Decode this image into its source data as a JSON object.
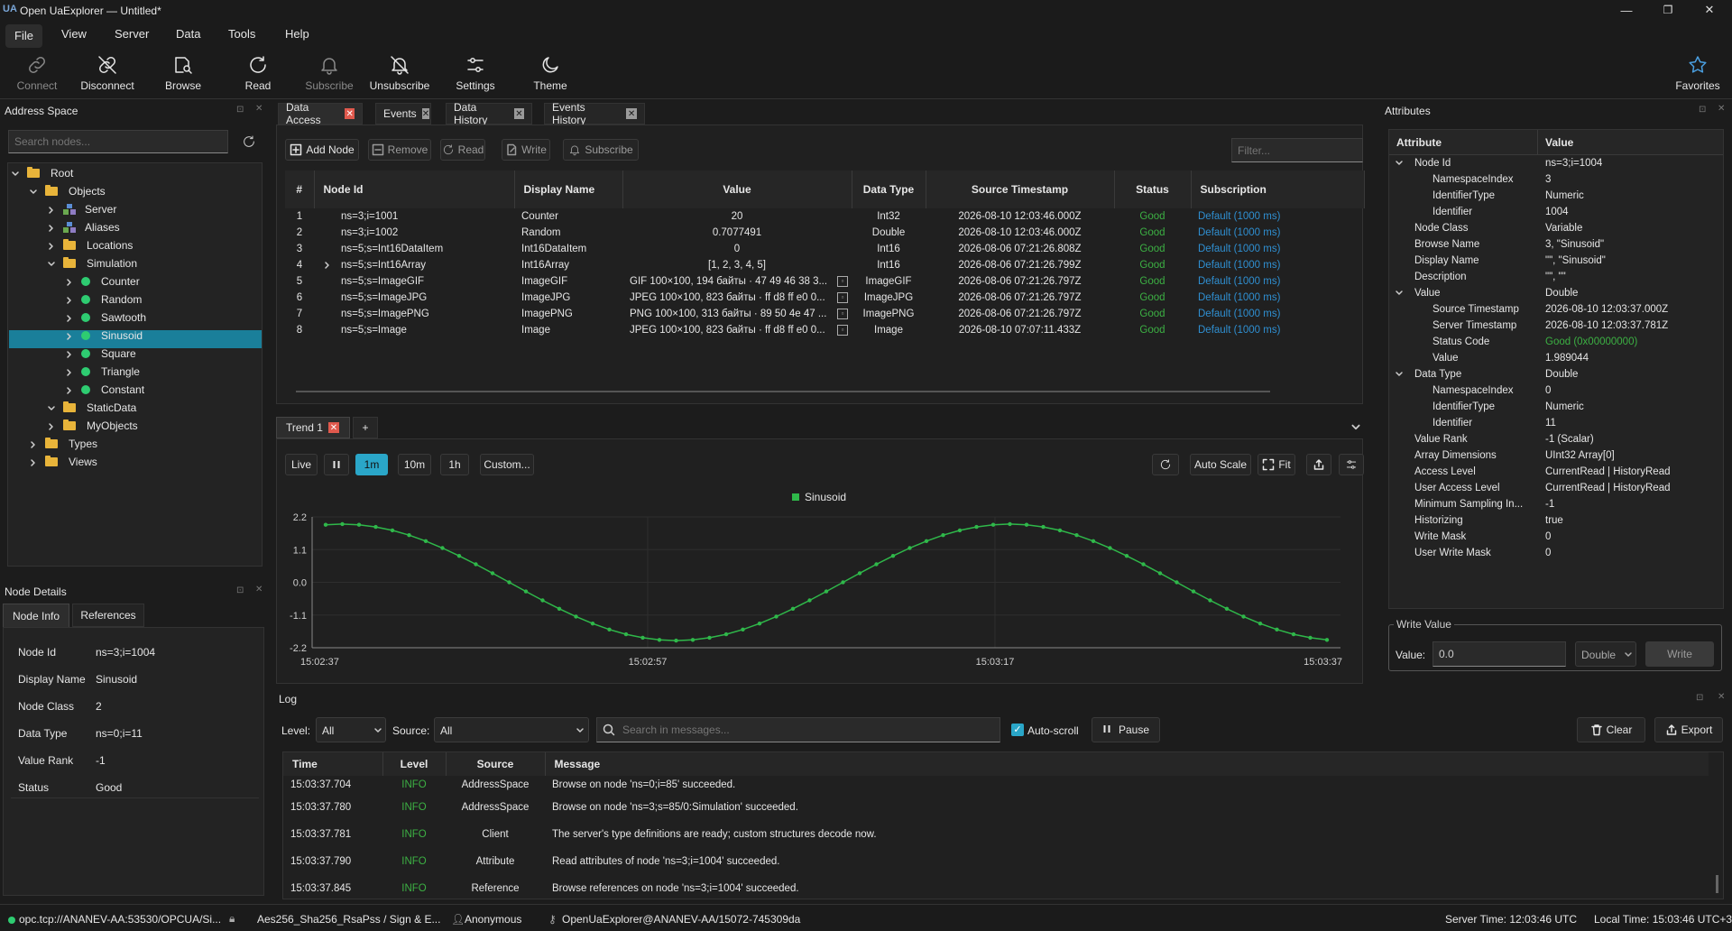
{
  "app": {
    "title": "Open UaExplorer — Untitled*",
    "logo": "UA"
  },
  "window": {
    "minimize": "—",
    "maximize": "❐",
    "close": "✕"
  },
  "menu": [
    "File",
    "View",
    "Server",
    "Data",
    "Tools",
    "Help"
  ],
  "toolbar": {
    "connect": "Connect",
    "disconnect": "Disconnect",
    "browse": "Browse",
    "read": "Read",
    "subscribe": "Subscribe",
    "unsubscribe": "Unsubscribe",
    "settings": "Settings",
    "theme": "Theme",
    "favorites": "Favorites"
  },
  "address_space": {
    "title": "Address Space",
    "search_placeholder": "Search nodes...",
    "tree": [
      "Root",
      "Objects",
      "Server",
      "Aliases",
      "Locations",
      "Simulation",
      "Counter",
      "Random",
      "Sawtooth",
      "Sinusoid",
      "Square",
      "Triangle",
      "Constant",
      "StaticData",
      "MyObjects",
      "Types",
      "Views"
    ]
  },
  "node_details": {
    "title": "Node Details",
    "tabs": [
      "Node Info",
      "References"
    ],
    "rows": [
      [
        "Node Id",
        "ns=3;i=1004"
      ],
      [
        "Display Name",
        "Sinusoid"
      ],
      [
        "Node Class",
        "2"
      ],
      [
        "Data Type",
        "ns=0;i=11"
      ],
      [
        "Value Rank",
        "-1"
      ],
      [
        "Status",
        "Good"
      ]
    ]
  },
  "tabs": [
    "Data Access",
    "Events",
    "Data History",
    "Events History"
  ],
  "data_access": {
    "buttons": [
      "Add Node",
      "Remove",
      "Read",
      "Write",
      "Subscribe"
    ],
    "filter_placeholder": "Filter...",
    "columns": [
      "#",
      "Node Id",
      "Display Name",
      "Value",
      "Data Type",
      "Source Timestamp",
      "Status",
      "Subscription"
    ],
    "rows": [
      [
        "1",
        "ns=3;i=1001",
        "Counter",
        "20",
        "Int32",
        "2026-08-10 12:03:46.000Z",
        "Good",
        "Default (1000 ms)"
      ],
      [
        "2",
        "ns=3;i=1002",
        "Random",
        "0.7077491",
        "Double",
        "2026-08-10 12:03:46.000Z",
        "Good",
        "Default (1000 ms)"
      ],
      [
        "3",
        "ns=5;s=Int16DataItem",
        "Int16DataItem",
        "0",
        "Int16",
        "2026-08-06 07:21:26.808Z",
        "Good",
        "Default (1000 ms)"
      ],
      [
        "4",
        "ns=5;s=Int16Array",
        "Int16Array",
        "[1, 2, 3, 4, 5]",
        "Int16",
        "2026-08-06 07:21:26.799Z",
        "Good",
        "Default (1000 ms)"
      ],
      [
        "5",
        "ns=5;s=ImageGIF",
        "ImageGIF",
        "GIF 100×100, 194 байты · 47 49 46 38 3...",
        "ImageGIF",
        "2026-08-06 07:21:26.797Z",
        "Good",
        "Default (1000 ms)"
      ],
      [
        "6",
        "ns=5;s=ImageJPG",
        "ImageJPG",
        "JPEG 100×100, 823 байты · ff d8 ff e0 0...",
        "ImageJPG",
        "2026-08-06 07:21:26.797Z",
        "Good",
        "Default (1000 ms)"
      ],
      [
        "7",
        "ns=5;s=ImagePNG",
        "ImagePNG",
        "PNG 100×100, 313 байты · 89 50 4e 47 ...",
        "ImagePNG",
        "2026-08-06 07:21:26.797Z",
        "Good",
        "Default (1000 ms)"
      ],
      [
        "8",
        "ns=5;s=Image",
        "Image",
        "JPEG 100×100, 823 байты · ff d8 ff e0 0...",
        "Image",
        "2026-08-10 07:07:11.433Z",
        "Good",
        "Default (1000 ms)"
      ]
    ]
  },
  "trend": {
    "tab": "Trend 1",
    "add": "+",
    "ranges": [
      "Live",
      "1m",
      "10m",
      "1h",
      "Custom..."
    ],
    "selected_range": "1m",
    "auto_scale": "Auto Scale",
    "fit": "Fit",
    "chart_data": {
      "type": "line",
      "series": [
        {
          "name": "Sinusoid",
          "color": "#2fb84a"
        }
      ],
      "yticks": [
        "2.2",
        "1.1",
        "0.0",
        "-1.1",
        "-2.2"
      ],
      "xticks": [
        "15:02:37",
        "15:02:57",
        "15:03:17",
        "15:03:37"
      ],
      "ylim": [
        -2.2,
        2.2
      ],
      "amplitude": 2.0,
      "period_s": 40
    }
  },
  "attributes": {
    "title": "Attributes",
    "columns": [
      "Attribute",
      "Value"
    ],
    "rows": [
      {
        "k": "Node Id",
        "v": "ns=3;i=1004",
        "lvl": 0,
        "exp": true
      },
      {
        "k": "NamespaceIndex",
        "v": "3",
        "lvl": 1
      },
      {
        "k": "IdentifierType",
        "v": "Numeric",
        "lvl": 1
      },
      {
        "k": "Identifier",
        "v": "1004",
        "lvl": 1
      },
      {
        "k": "Node Class",
        "v": "Variable",
        "lvl": 0
      },
      {
        "k": "Browse Name",
        "v": "3, \"Sinusoid\"",
        "lvl": 0
      },
      {
        "k": "Display Name",
        "v": "\"\", \"Sinusoid\"",
        "lvl": 0
      },
      {
        "k": "Description",
        "v": "\"\", \"\"",
        "lvl": 0
      },
      {
        "k": "Value",
        "v": "Double",
        "lvl": 0,
        "exp": true
      },
      {
        "k": "Source Timestamp",
        "v": "2026-08-10 12:03:37.000Z",
        "lvl": 1
      },
      {
        "k": "Server Timestamp",
        "v": "2026-08-10 12:03:37.781Z",
        "lvl": 1
      },
      {
        "k": "Status Code",
        "v": "Good (0x00000000)",
        "lvl": 1,
        "good": true
      },
      {
        "k": "Value",
        "v": "1.989044",
        "lvl": 1
      },
      {
        "k": "Data Type",
        "v": "Double",
        "lvl": 0,
        "exp": true
      },
      {
        "k": "NamespaceIndex",
        "v": "0",
        "lvl": 1
      },
      {
        "k": "IdentifierType",
        "v": "Numeric",
        "lvl": 1
      },
      {
        "k": "Identifier",
        "v": "11",
        "lvl": 1
      },
      {
        "k": "Value Rank",
        "v": "-1 (Scalar)",
        "lvl": 0
      },
      {
        "k": "Array Dimensions",
        "v": "UInt32 Array[0]",
        "lvl": 0
      },
      {
        "k": "Access Level",
        "v": "CurrentRead | HistoryRead",
        "lvl": 0
      },
      {
        "k": "User Access Level",
        "v": "CurrentRead | HistoryRead",
        "lvl": 0
      },
      {
        "k": "Minimum Sampling In...",
        "v": "-1",
        "lvl": 0
      },
      {
        "k": "Historizing",
        "v": "true",
        "lvl": 0
      },
      {
        "k": "Write Mask",
        "v": "0",
        "lvl": 0
      },
      {
        "k": "User Write Mask",
        "v": "0",
        "lvl": 0
      }
    ]
  },
  "write_value": {
    "title": "Write Value",
    "label": "Value:",
    "value": "0.0",
    "type": "Double",
    "button": "Write"
  },
  "log": {
    "title": "Log",
    "level_label": "Level:",
    "level": "All",
    "source_label": "Source:",
    "source": "All",
    "search_placeholder": "Search in messages...",
    "autoscroll": "Auto-scroll",
    "pause": "Pause",
    "clear": "Clear",
    "export": "Export",
    "columns": [
      "Time",
      "Level",
      "Source",
      "Message"
    ],
    "rows": [
      [
        "15:03:37.704",
        "INFO",
        "AddressSpace",
        "Browse on node 'ns=0;i=85' succeeded."
      ],
      [
        "15:03:37.780",
        "INFO",
        "AddressSpace",
        "Browse on node 'ns=3;s=85/0:Simulation' succeeded."
      ],
      [
        "15:03:37.781",
        "INFO",
        "Client",
        "The server's type definitions are ready; custom structures decode now."
      ],
      [
        "15:03:37.790",
        "INFO",
        "Attribute",
        "Read attributes of node 'ns=3;i=1004' succeeded."
      ],
      [
        "15:03:37.845",
        "INFO",
        "Reference",
        "Browse references on node 'ns=3;i=1004' succeeded."
      ]
    ]
  },
  "status": {
    "endpoint": "opc.tcp://ANANEV-AA:53530/OPCUA/Si...",
    "security": "Aes256_Sha256_RsaPss / Sign & E...",
    "user": "Anonymous",
    "session": "OpenUaExplorer@ANANEV-AA/15072-745309da",
    "server_time": "Server Time: 12:03:46 UTC",
    "local_time": "Local Time: 15:03:46 UTC+3"
  }
}
